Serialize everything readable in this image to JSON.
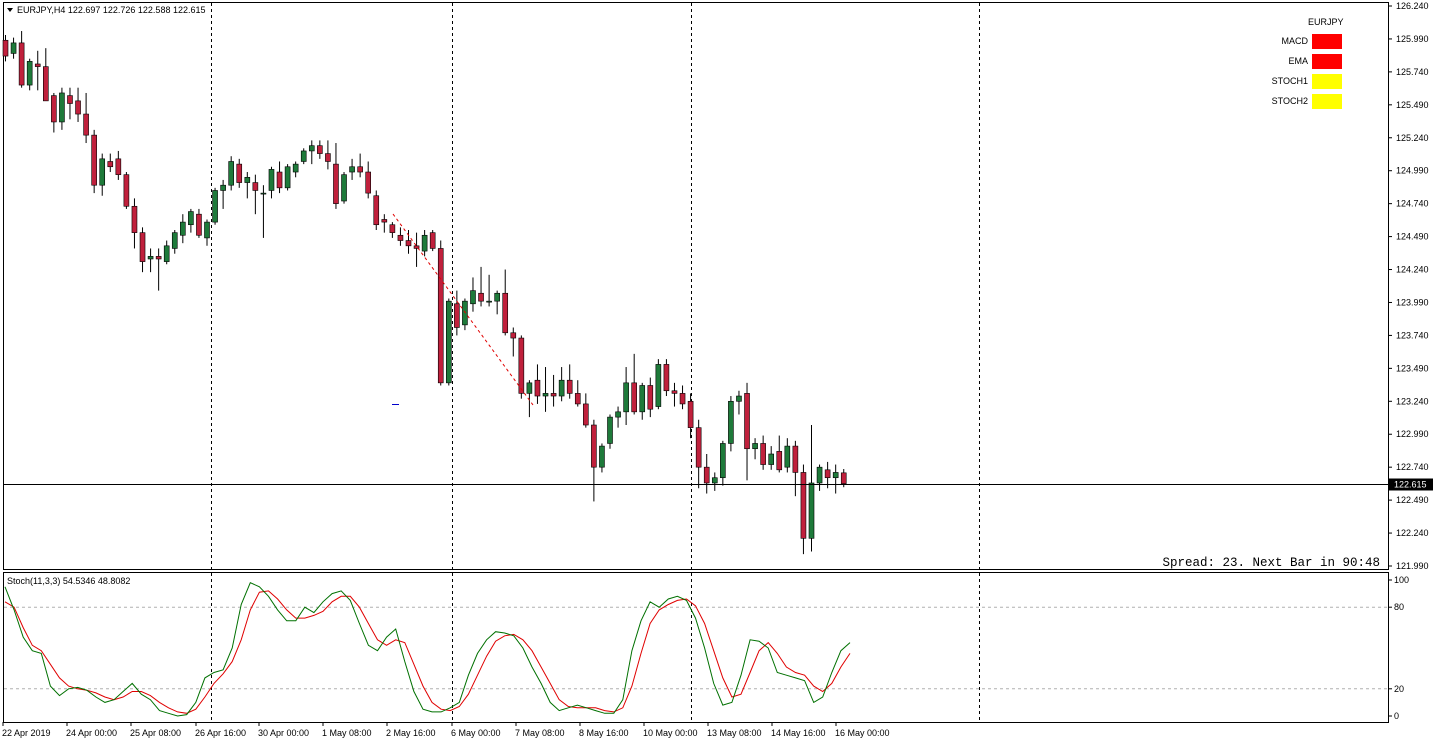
{
  "main": {
    "header": "EURJPY,H4  122.697 122.726 122.588 122.615",
    "price_label": "122.615",
    "spread_text": "Spread: 23. Next Bar in 90:48",
    "y_min": 121.99,
    "y_max": 126.24,
    "current_price": 122.615,
    "y_ticks": [
      "126.240",
      "125.990",
      "125.740",
      "125.490",
      "125.240",
      "124.990",
      "124.740",
      "124.490",
      "124.240",
      "123.990",
      "123.740",
      "123.490",
      "123.240",
      "122.990",
      "122.740",
      "122.490",
      "122.240",
      "121.990"
    ],
    "colors": {
      "bull": "#1e7a3a",
      "bear": "#c0203c",
      "grid": "#000000"
    }
  },
  "indicator_panel": {
    "title": "EURJPY",
    "rows": [
      {
        "label": "MACD",
        "color": "#ff0000"
      },
      {
        "label": "EMA",
        "color": "#ff0000"
      },
      {
        "label": "STOCH1",
        "color": "#ffff00"
      },
      {
        "label": "STOCH2",
        "color": "#ffff00"
      }
    ]
  },
  "stoch": {
    "label": "Stoch(11,3,3) 54.5346 48.8082",
    "ticks": [
      "100",
      "80",
      "20",
      "0"
    ],
    "levels": [
      80,
      20
    ],
    "main_color": "#007000",
    "signal_color": "#e00000",
    "k": [
      95,
      78,
      58,
      48,
      46,
      22,
      15,
      20,
      21,
      19,
      14,
      10,
      12,
      18,
      24,
      16,
      12,
      4,
      2,
      0,
      1,
      10,
      28,
      32,
      34,
      50,
      82,
      98,
      95,
      88,
      78,
      70,
      70,
      80,
      76,
      84,
      90,
      92,
      85,
      68,
      52,
      48,
      58,
      64,
      40,
      18,
      5,
      3,
      3,
      6,
      10,
      30,
      46,
      56,
      62,
      61,
      59,
      50,
      36,
      24,
      10,
      4,
      6,
      8,
      6,
      4,
      2,
      2,
      12,
      48,
      70,
      84,
      80,
      86,
      88,
      85,
      72,
      50,
      24,
      8,
      10,
      30,
      56,
      55,
      50,
      32,
      30,
      28,
      26,
      10,
      14,
      32,
      48,
      54
    ],
    "d": [
      84,
      80,
      65,
      52,
      48,
      38,
      28,
      22,
      20,
      19,
      17,
      14,
      12,
      14,
      18,
      18,
      15,
      10,
      6,
      3,
      2,
      5,
      14,
      24,
      31,
      40,
      56,
      78,
      91,
      92,
      86,
      78,
      72,
      72,
      74,
      77,
      84,
      88,
      88,
      80,
      68,
      56,
      52,
      56,
      54,
      38,
      22,
      10,
      5,
      4,
      7,
      16,
      30,
      44,
      55,
      59,
      60,
      56,
      48,
      36,
      24,
      12,
      7,
      6,
      6,
      6,
      4,
      3,
      6,
      22,
      46,
      68,
      78,
      82,
      85,
      86,
      81,
      68,
      48,
      28,
      14,
      16,
      32,
      48,
      54,
      46,
      36,
      32,
      30,
      22,
      18,
      24,
      36,
      46
    ]
  },
  "chart_data": {
    "type": "candlestick",
    "title": "EURJPY,H4",
    "x_labels": [
      "22 Apr 2019",
      "24 Apr 00:00",
      "25 Apr 08:00",
      "26 Apr 16:00",
      "30 Apr 00:00",
      "1 May 08:00",
      "2 May 16:00",
      "6 May 00:00",
      "7 May 08:00",
      "8 May 16:00",
      "10 May 00:00",
      "13 May 08:00",
      "14 May 16:00",
      "16 May 00:00"
    ],
    "ylim": [
      121.99,
      126.24
    ],
    "ohlc": [
      [
        125.98,
        126.02,
        125.82,
        125.86
      ],
      [
        125.88,
        126.0,
        125.84,
        125.96
      ],
      [
        125.96,
        126.05,
        125.62,
        125.64
      ],
      [
        125.64,
        125.84,
        125.6,
        125.82
      ],
      [
        125.8,
        125.9,
        125.6,
        125.78
      ],
      [
        125.78,
        125.92,
        125.52,
        125.52
      ],
      [
        125.56,
        125.58,
        125.28,
        125.36
      ],
      [
        125.36,
        125.62,
        125.3,
        125.58
      ],
      [
        125.56,
        125.62,
        125.38,
        125.5
      ],
      [
        125.52,
        125.62,
        125.36,
        125.42
      ],
      [
        125.42,
        125.58,
        125.2,
        125.26
      ],
      [
        125.26,
        125.3,
        124.82,
        124.88
      ],
      [
        124.88,
        125.12,
        124.8,
        125.08
      ],
      [
        125.06,
        125.12,
        124.98,
        125.02
      ],
      [
        125.08,
        125.14,
        124.92,
        124.96
      ],
      [
        124.96,
        124.98,
        124.7,
        124.72
      ],
      [
        124.72,
        124.78,
        124.4,
        124.52
      ],
      [
        124.52,
        124.56,
        124.22,
        124.3
      ],
      [
        124.32,
        124.4,
        124.22,
        124.34
      ],
      [
        124.34,
        124.4,
        124.08,
        124.32
      ],
      [
        124.3,
        124.46,
        124.28,
        124.42
      ],
      [
        124.4,
        124.54,
        124.36,
        124.52
      ],
      [
        124.5,
        124.66,
        124.44,
        124.6
      ],
      [
        124.58,
        124.7,
        124.52,
        124.68
      ],
      [
        124.66,
        124.7,
        124.48,
        124.5
      ],
      [
        124.48,
        124.62,
        124.42,
        124.6
      ],
      [
        124.6,
        124.86,
        124.58,
        124.84
      ],
      [
        124.84,
        124.92,
        124.7,
        124.88
      ],
      [
        124.88,
        125.1,
        124.84,
        125.06
      ],
      [
        125.04,
        125.08,
        124.86,
        124.9
      ],
      [
        124.9,
        124.98,
        124.78,
        124.94
      ],
      [
        124.9,
        124.96,
        124.66,
        124.84
      ],
      [
        124.82,
        124.88,
        124.48,
        124.82
      ],
      [
        124.84,
        125.02,
        124.78,
        125.0
      ],
      [
        124.98,
        125.06,
        124.82,
        124.86
      ],
      [
        124.86,
        125.04,
        124.84,
        125.02
      ],
      [
        124.98,
        125.06,
        124.94,
        125.04
      ],
      [
        125.06,
        125.16,
        125.04,
        125.14
      ],
      [
        125.14,
        125.22,
        125.04,
        125.18
      ],
      [
        125.18,
        125.22,
        125.08,
        125.12
      ],
      [
        125.12,
        125.22,
        125.0,
        125.06
      ],
      [
        125.04,
        125.2,
        124.7,
        124.74
      ],
      [
        124.76,
        124.98,
        124.74,
        124.96
      ],
      [
        124.98,
        125.08,
        124.92,
        125.02
      ],
      [
        125.02,
        125.12,
        124.94,
        124.98
      ],
      [
        124.98,
        125.06,
        124.78,
        124.82
      ],
      [
        124.8,
        124.84,
        124.54,
        124.58
      ],
      [
        124.62,
        124.66,
        124.52,
        124.6
      ],
      [
        124.58,
        124.6,
        124.48,
        124.52
      ],
      [
        124.5,
        124.56,
        124.42,
        124.46
      ],
      [
        124.46,
        124.54,
        124.36,
        124.42
      ],
      [
        124.42,
        124.52,
        124.26,
        124.4
      ],
      [
        124.38,
        124.54,
        124.34,
        124.5
      ],
      [
        124.52,
        124.54,
        124.38,
        124.4
      ],
      [
        124.4,
        124.46,
        123.36,
        123.38
      ],
      [
        123.38,
        124.02,
        123.36,
        124.0
      ],
      [
        123.98,
        124.08,
        123.74,
        123.8
      ],
      [
        123.82,
        124.02,
        123.78,
        124.0
      ],
      [
        123.98,
        124.18,
        123.92,
        124.08
      ],
      [
        124.06,
        124.26,
        123.96,
        124.0
      ],
      [
        124.0,
        124.2,
        123.96,
        124.0
      ],
      [
        124.0,
        124.08,
        123.9,
        124.06
      ],
      [
        124.06,
        124.24,
        123.74,
        123.76
      ],
      [
        123.76,
        123.8,
        123.58,
        123.72
      ],
      [
        123.72,
        123.74,
        123.26,
        123.3
      ],
      [
        123.3,
        123.4,
        123.12,
        123.38
      ],
      [
        123.4,
        123.52,
        123.22,
        123.28
      ],
      [
        123.28,
        123.5,
        123.16,
        123.3
      ],
      [
        123.3,
        123.44,
        123.2,
        123.28
      ],
      [
        123.28,
        123.5,
        123.24,
        123.4
      ],
      [
        123.4,
        123.52,
        123.26,
        123.3
      ],
      [
        123.3,
        123.4,
        123.2,
        123.22
      ],
      [
        123.22,
        123.3,
        123.04,
        123.06
      ],
      [
        123.06,
        123.1,
        122.48,
        122.74
      ],
      [
        122.74,
        122.92,
        122.7,
        122.9
      ],
      [
        122.92,
        123.14,
        122.88,
        123.12
      ],
      [
        123.12,
        123.2,
        123.04,
        123.16
      ],
      [
        123.16,
        123.5,
        123.06,
        123.38
      ],
      [
        123.38,
        123.6,
        123.14,
        123.16
      ],
      [
        123.16,
        123.38,
        123.1,
        123.36
      ],
      [
        123.36,
        123.42,
        123.12,
        123.18
      ],
      [
        123.2,
        123.56,
        123.18,
        123.52
      ],
      [
        123.52,
        123.56,
        123.28,
        123.32
      ],
      [
        123.32,
        123.38,
        123.2,
        123.3
      ],
      [
        123.3,
        123.36,
        123.18,
        123.22
      ],
      [
        123.24,
        123.3,
        122.96,
        123.04
      ],
      [
        123.04,
        123.1,
        122.58,
        122.74
      ],
      [
        122.74,
        122.84,
        122.54,
        122.62
      ],
      [
        122.62,
        122.7,
        122.56,
        122.66
      ],
      [
        122.66,
        122.94,
        122.6,
        122.92
      ],
      [
        122.92,
        123.28,
        122.86,
        123.24
      ],
      [
        123.24,
        123.32,
        123.14,
        123.28
      ],
      [
        123.3,
        123.38,
        122.64,
        122.88
      ],
      [
        122.88,
        122.96,
        122.8,
        122.92
      ],
      [
        122.92,
        122.98,
        122.72,
        122.76
      ],
      [
        122.76,
        122.9,
        122.72,
        122.84
      ],
      [
        122.86,
        122.98,
        122.7,
        122.72
      ],
      [
        122.74,
        122.96,
        122.7,
        122.9
      ],
      [
        122.9,
        122.94,
        122.52,
        122.7
      ],
      [
        122.7,
        122.76,
        122.08,
        122.2
      ],
      [
        122.2,
        123.06,
        122.1,
        122.62
      ],
      [
        122.62,
        122.76,
        122.56,
        122.74
      ],
      [
        122.72,
        122.78,
        122.58,
        122.66
      ],
      [
        122.66,
        122.76,
        122.54,
        122.7
      ],
      [
        122.697,
        122.726,
        122.588,
        122.615
      ]
    ]
  }
}
